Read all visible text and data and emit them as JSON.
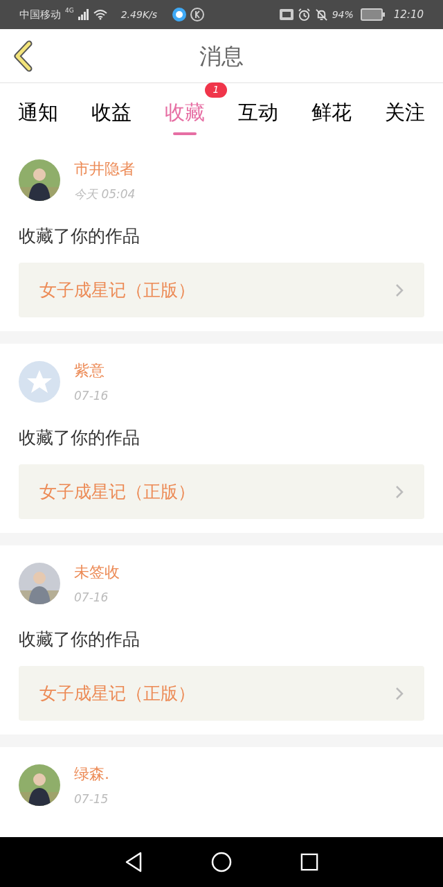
{
  "status_bar": {
    "carrier": "中国移动",
    "network": "4G",
    "speed": "2.49K/s",
    "battery": "94%",
    "time": "12:10"
  },
  "header": {
    "title": "消息"
  },
  "tabs": [
    {
      "label": "通知",
      "selected": false
    },
    {
      "label": "收益",
      "selected": false
    },
    {
      "label": "收藏",
      "selected": true,
      "badge": "1"
    },
    {
      "label": "互动",
      "selected": false
    },
    {
      "label": "鲜花",
      "selected": false
    },
    {
      "label": "关注",
      "selected": false
    }
  ],
  "messages": [
    {
      "kind": "picture",
      "name": "市井隐者",
      "time": "今天 05:04",
      "action": "收藏了你的作品",
      "work": "女子成星记（正版）"
    },
    {
      "kind": "default",
      "name": "紫意",
      "time": "07-16",
      "action": "收藏了你的作品",
      "work": "女子成星记（正版）"
    },
    {
      "kind": "picture",
      "name": "未签收",
      "time": "07-16",
      "action": "收藏了你的作品",
      "work": "女子成星记（正版）"
    },
    {
      "kind": "picture",
      "name": "绿森.",
      "time": "07-15"
    }
  ]
}
